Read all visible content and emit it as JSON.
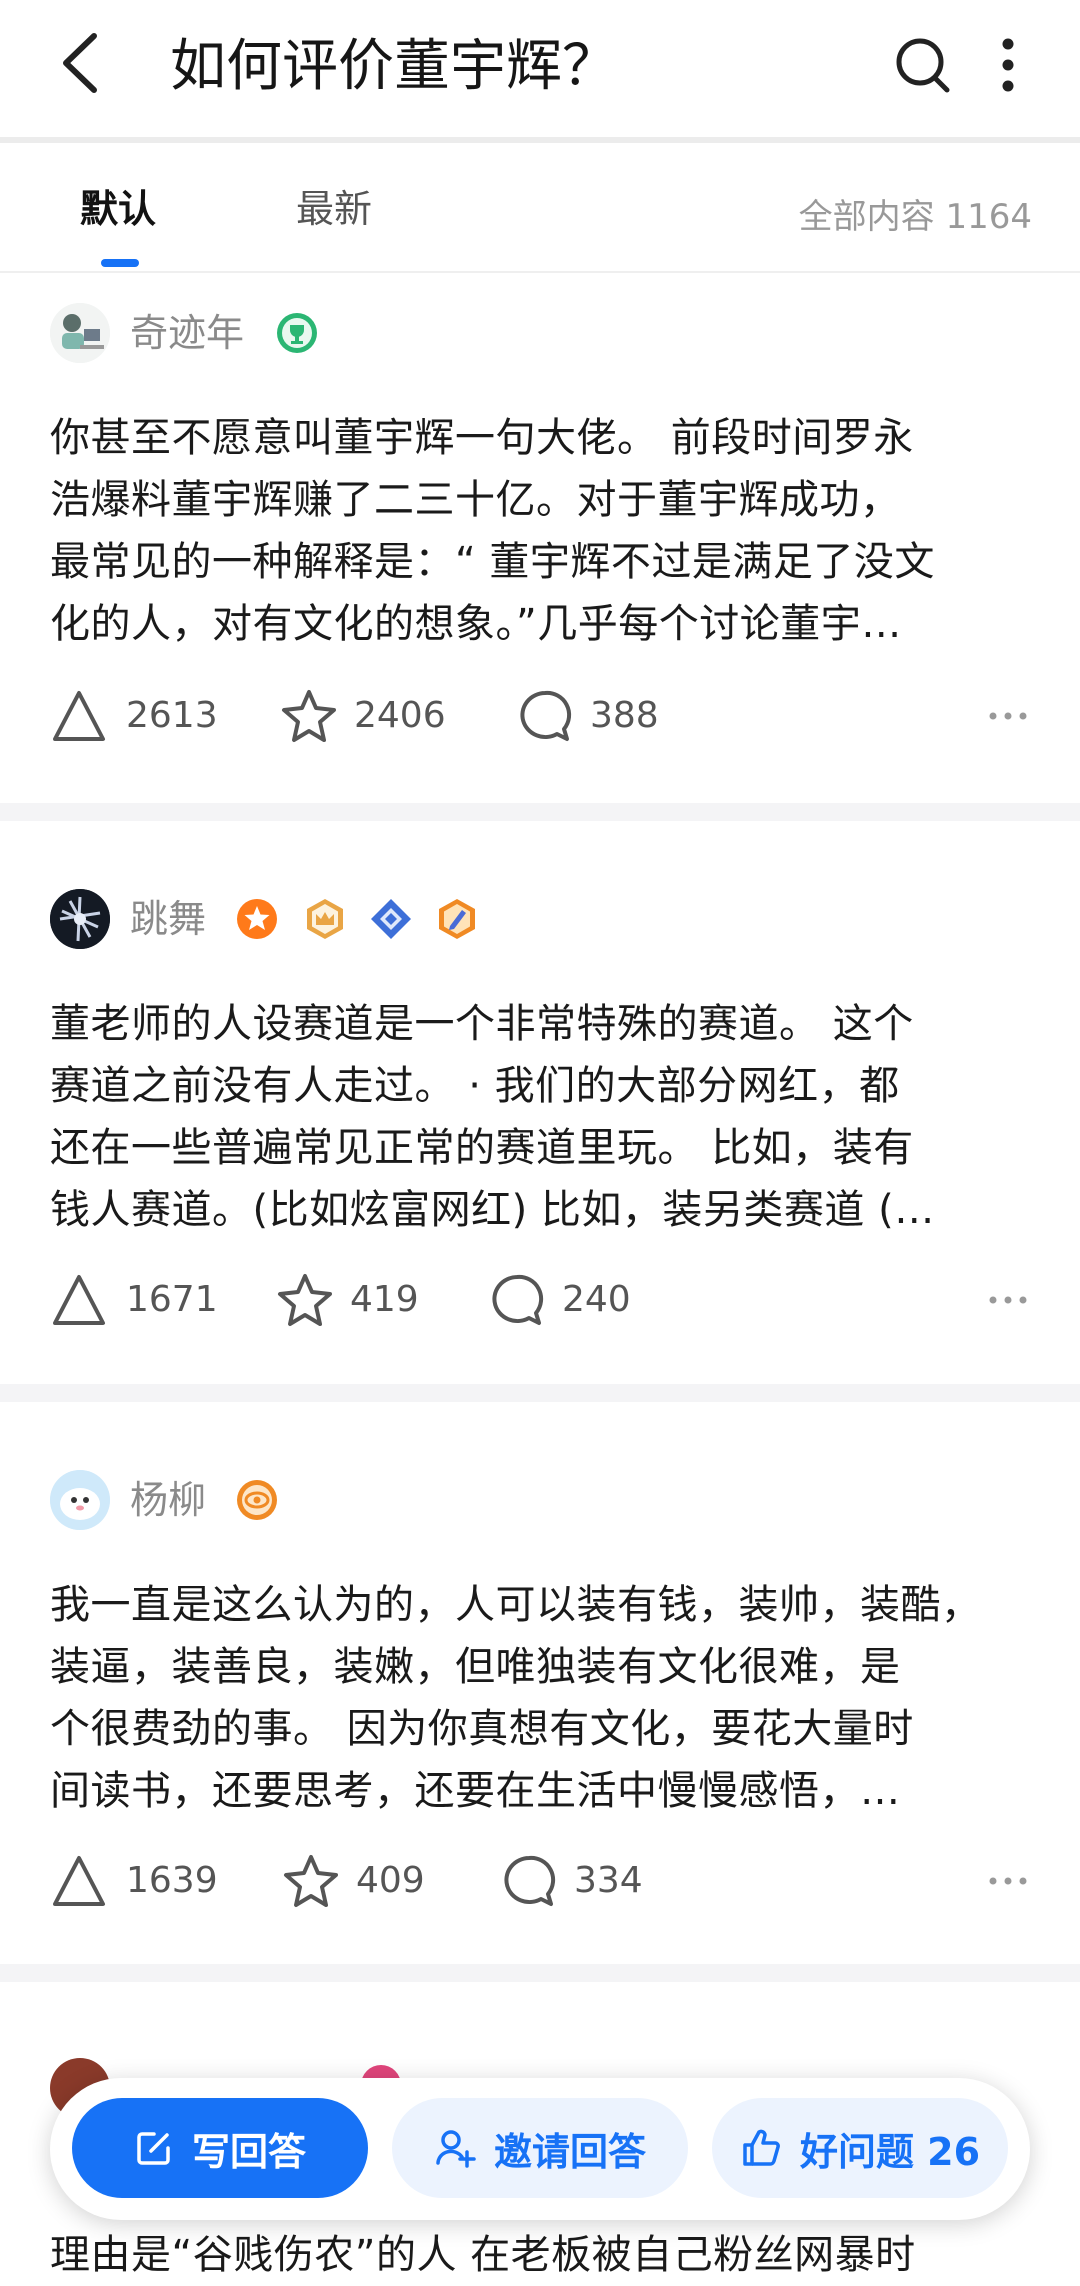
{
  "header": {
    "title": "如何评价董宇辉？",
    "back_icon": "back-arrow-icon",
    "search_icon": "search-icon",
    "more_icon": "more-vertical-icon"
  },
  "tabs": {
    "items": [
      "默认",
      "最新"
    ],
    "active": "默认",
    "total_label": "全部内容 1164"
  },
  "answers": [
    {
      "author": "奇迹年",
      "badges": [
        "trophy-badge-icon"
      ],
      "lines": [
        "你甚至不愿意叫董宇辉一句大佬。 前段时间罗永",
        "浩爆料董宇辉赚了二三十亿。对于董宇辉成功，",
        "最常见的一种解释是：“ 董宇辉不过是满足了没文",
        "化的人，对有文化的想象。”几乎每个讨论董宇…"
      ],
      "likes": "2613",
      "favorites": "2406",
      "comments": "388"
    },
    {
      "author": "跳舞",
      "badges": [
        "star-badge-icon",
        "crown-badge-icon",
        "diamond-badge-icon",
        "pencil-badge-icon"
      ],
      "lines": [
        "董老师的人设赛道是一个非常特殊的赛道。 这个",
        "赛道之前没有人走过。 · 我们的大部分网红，都",
        "还在一些普遍常见正常的赛道里玩。 比如，装有",
        "钱人赛道。(比如炫富网红) 比如，装另类赛道 (…"
      ],
      "likes": "1671",
      "favorites": "419",
      "comments": "240"
    },
    {
      "author": "杨柳",
      "badges": [
        "eye-badge-icon"
      ],
      "lines": [
        "我一直是这么认为的，人可以装有钱，装帅，装酷，",
        "装逼，装善良，装嫩，但唯独装有文化很难，是",
        "个很费劲的事。 因为你真想有文化，要花大量时",
        "间读书，还要思考，还要在生活中慢慢感悟，…"
      ],
      "likes": "1639",
      "favorites": "409",
      "comments": "334"
    }
  ],
  "partial_answer": {
    "last_line": "理由是“谷贱伤农”的人 在老板被自己粉丝网暴时"
  },
  "action_bar": {
    "write": "写回答",
    "invite": "邀请回答",
    "good_question": "好问题 26"
  },
  "colors": {
    "accent": "#1772f6",
    "separator": "#f4f4f6"
  }
}
